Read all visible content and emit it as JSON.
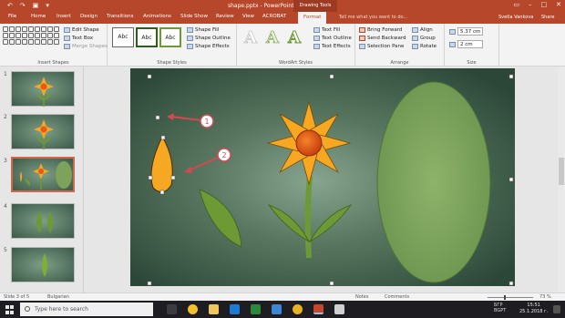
{
  "titlebar": {
    "doc_title": "shape.pptx - PowerPoint",
    "tools_tab": "Drawing Tools",
    "qat": [
      "↶",
      "↷",
      "▣",
      "▾"
    ],
    "window": [
      "▭",
      "–",
      "□",
      "✕"
    ]
  },
  "tabs": [
    "File",
    "Home",
    "Insert",
    "Design",
    "Transitions",
    "Animations",
    "Slide Show",
    "Review",
    "View",
    "ACROBAT",
    "Format"
  ],
  "tellme": "Tell me what you want to do...",
  "user": "Svetla Vankova",
  "share": "Share",
  "ribbon": {
    "insert_shapes": {
      "label": "Insert Shapes",
      "edit_shape": "Edit Shape",
      "text_box": "Text Box",
      "merge_shapes": "Merge Shapes"
    },
    "shape_styles": {
      "label": "Shape Styles",
      "preset": [
        "Abc",
        "Abc",
        "Abc"
      ],
      "shape_fill": "Shape Fill",
      "shape_outline": "Shape Outline",
      "shape_effects": "Shape Effects"
    },
    "wordart": {
      "label": "WordArt Styles",
      "letters": [
        "A",
        "A",
        "A"
      ],
      "text_fill": "Text Fill",
      "text_outline": "Text Outline",
      "text_effects": "Text Effects"
    },
    "arrange": {
      "label": "Arrange",
      "bring_forward": "Bring Forward",
      "send_backward": "Send Backward",
      "selection_pane": "Selection Pane",
      "align": "Align",
      "group": "Group",
      "rotate": "Rotate"
    },
    "size": {
      "label": "Size",
      "height": "5.37 cm",
      "width": "2 cm"
    }
  },
  "thumbnails": {
    "numbers": [
      "1",
      "2",
      "3",
      "4",
      "5"
    ]
  },
  "callouts": [
    "1",
    "2"
  ],
  "status": {
    "slide": "Slide 3 of 5",
    "language": "Bulgarian",
    "notes": "Notes",
    "comments": "Comments",
    "zoom": "73 %"
  },
  "taskbar": {
    "search_placeholder": "Type here to search",
    "lang": "БГР",
    "time": "15:51",
    "lang2": "BGPT",
    "date": "25.1.2018 г."
  },
  "colors": {
    "accent": "#b7472a",
    "petal": "#f7a823",
    "leaf": "#6e9a35"
  }
}
